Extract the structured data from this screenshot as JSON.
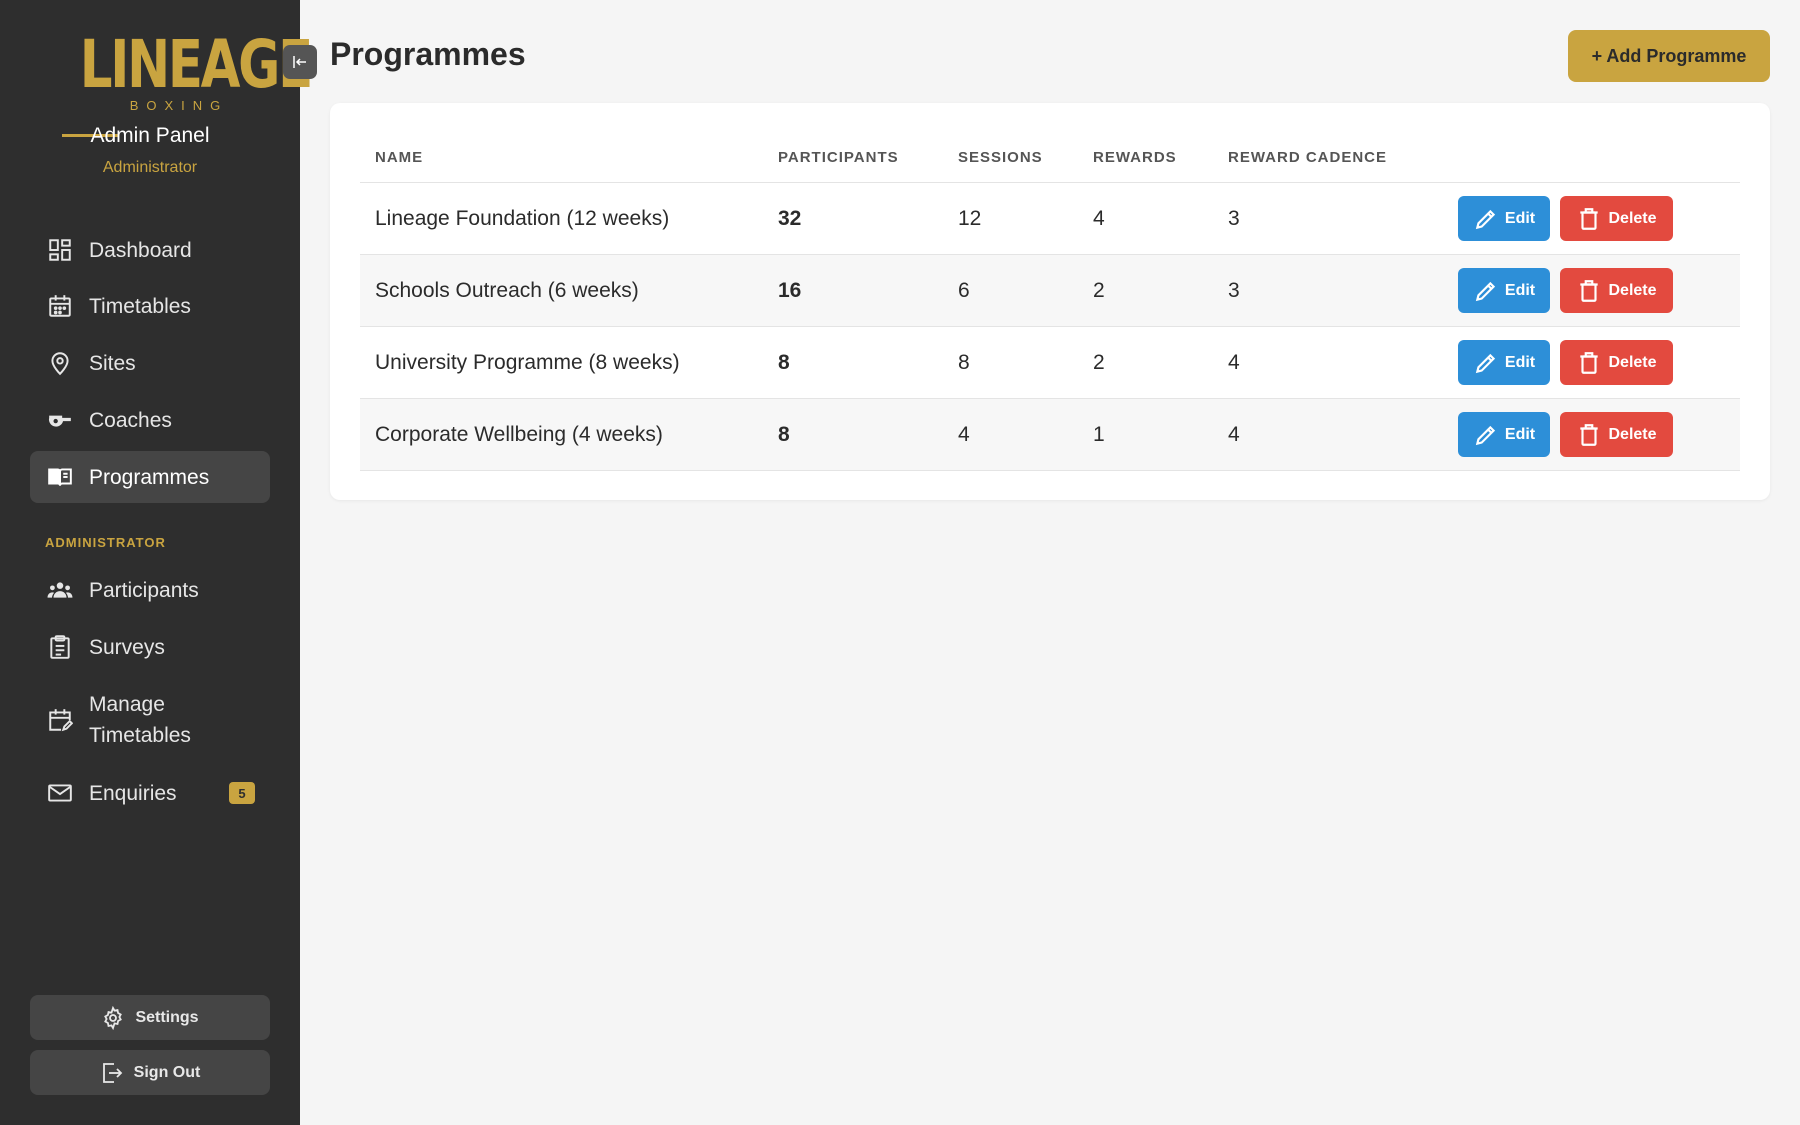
{
  "sidebar": {
    "logo": {
      "word": "LINEAGE",
      "sub": "BOXING"
    },
    "panel_title": "Admin Panel",
    "panel_role": "Administrator",
    "items": [
      {
        "label": "Dashboard",
        "icon": "dashboard-icon"
      },
      {
        "label": "Timetables",
        "icon": "calendar-icon"
      },
      {
        "label": "Sites",
        "icon": "location-pin-icon"
      },
      {
        "label": "Coaches",
        "icon": "whistle-icon"
      },
      {
        "label": "Programmes",
        "icon": "book-icon",
        "active": true
      }
    ],
    "section_label": "ADMINISTRATOR",
    "admin_items": [
      {
        "label": "Participants",
        "icon": "people-icon"
      },
      {
        "label": "Surveys",
        "icon": "clipboard-icon"
      },
      {
        "label": "Manage Timetables",
        "label_line1": "Manage",
        "label_line2": "Timetables",
        "icon": "calendar-edit-icon"
      },
      {
        "label": "Enquiries",
        "icon": "mail-icon",
        "badge": "5"
      }
    ],
    "settings_label": "Settings",
    "signout_label": "Sign Out"
  },
  "main": {
    "title": "Programmes",
    "add_button": "+ Add Programme",
    "columns": [
      "NAME",
      "PARTICIPANTS",
      "SESSIONS",
      "REWARDS",
      "REWARD CADENCE"
    ],
    "rows": [
      {
        "name": "Lineage Foundation (12 weeks)",
        "participants": "32",
        "sessions": "12",
        "rewards": "4",
        "cadence": "3"
      },
      {
        "name": "Schools Outreach (6 weeks)",
        "participants": "16",
        "sessions": "6",
        "rewards": "2",
        "cadence": "3"
      },
      {
        "name": "University Programme (8 weeks)",
        "participants": "8",
        "sessions": "8",
        "rewards": "2",
        "cadence": "4"
      },
      {
        "name": "Corporate Wellbeing (4 weeks)",
        "participants": "8",
        "sessions": "4",
        "rewards": "1",
        "cadence": "4"
      }
    ],
    "edit_label": "Edit",
    "delete_label": "Delete"
  },
  "colors": {
    "sidebar_bg": "#2e2e2e",
    "accent_gold": "#c9a440",
    "edit_blue": "#2d8fd8",
    "delete_red": "#e34a3f",
    "page_bg": "#f5f5f5"
  }
}
